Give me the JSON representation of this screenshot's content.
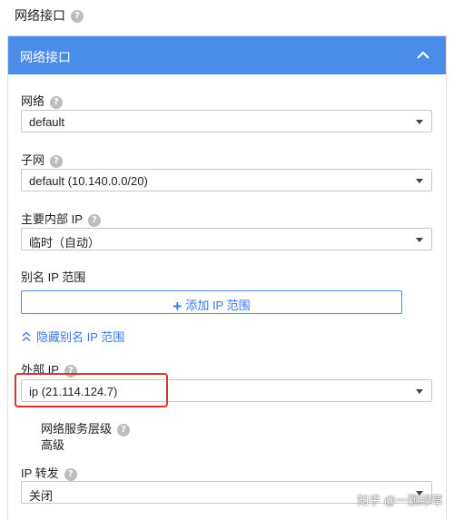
{
  "section": {
    "title": "网络接口",
    "help": "?"
  },
  "panel": {
    "title": "网络接口",
    "header_color": "#4a8cea",
    "collapse_icon": "chevron-up-icon"
  },
  "network": {
    "label": "网络",
    "value": "default"
  },
  "subnet": {
    "label": "子网",
    "value": "default (10.140.0.0/20)"
  },
  "internal_ip": {
    "label": "主要内部 IP",
    "value": "临时（自动）"
  },
  "alias": {
    "label": "别名 IP 范围",
    "add_button": "添加 IP 范围",
    "hide_link": "隐藏别名 IP 范围"
  },
  "external_ip": {
    "label": "外部 IP",
    "value": "ip (21.114.124.7)"
  },
  "network_tier": {
    "label": "网络服务层级",
    "value": "高级"
  },
  "ip_forwarding": {
    "label": "IP 转发",
    "value": "关闭"
  },
  "watermark": "知乎 @一颗绿草",
  "accent_color": "#3b78e7",
  "highlight_color": "#d9332f"
}
